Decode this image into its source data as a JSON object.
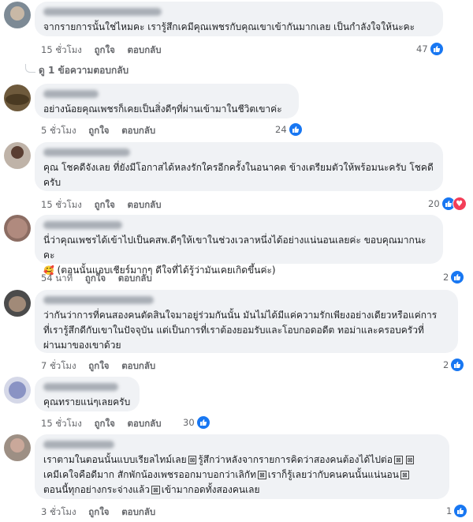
{
  "colors": {
    "bubble": "#f0f2f5",
    "like": "#1877f2",
    "love": "#f33e58",
    "meta": "#65676b"
  },
  "icons": {
    "like": "like-thumb-icon",
    "love": "love-heart-icon"
  },
  "comments": [
    {
      "text": "จากรายการนั้นใช่ไหมคะ เรารู้สึกเคมีคุณเพชรกับคุณเขาเข้ากันมากเลย เป็นกำลังใจให้นะคะ",
      "time": "15 ชั่วโมง",
      "like": "ถูกใจ",
      "reply": "ตอบกลับ",
      "count": "47",
      "replies": "ดู 1 ข้อความตอบกลับ"
    },
    {
      "text": "อย่างน้อยคุณเพชรก็เคยเป็นสิ่งดีๆที่ผ่านเข้ามาในชีวิตเขาค่ะ",
      "time": "5 ชั่วโมง",
      "like": "ถูกใจ",
      "reply": "ตอบกลับ",
      "count": "24"
    },
    {
      "line1": "คุณ โชคดีจังเลย ที่ยังมีโอกาสได้หลงรักใครอีกครั้งในอนาคต ข้างเตรียมตัวให้พร้อมนะครับ โชคดี",
      "line2": "ครับ",
      "time": "15 ชั่วโมง",
      "like": "ถูกใจ",
      "reply": "ตอบกลับ",
      "count": "20"
    },
    {
      "line1": "นี่ว่าคุณเพชรได้เข้าไปเป็นคสพ.ดีๆให้เขาในช่วงเวลาหนึ่งได้อย่างแน่นอนเลยค่ะ ขอบคุณมากนะคะ",
      "emoji": "🥰",
      "line2": "(ตอนนั้นแอบเชียร์มากๆ ดีใจที่ได้รู้ว่ามันเคยเกิดขึ้นค่ะ)",
      "time": "54 นาที",
      "like": "ถูกใจ",
      "reply": "ตอบกลับ",
      "count": "2"
    },
    {
      "line1": "ว่ากันว่าการที่คนสองคนตัดสินใจมาอยู่ร่วมกันนั้น มันไม่ได้มีแค่ความรักเพียงอย่างเดียวหรือแค่การ",
      "line2": "ที่เรารู้สึกดีกับเขาในปัจจุบัน แต่เป็นการที่เราต้องยอมรับและโอบกอดอดีต ทอม่าและครอบครัวที่",
      "line3": "ผ่านมาของเขาด้วย",
      "time": "7 ชั่วโมง",
      "like": "ถูกใจ",
      "reply": "ตอบกลับ",
      "count": "2"
    },
    {
      "text": "คุณทรายแน่ๆเลยครับ",
      "time": "15 ชั่วโมง",
      "like": "ถูกใจ",
      "reply": "ตอบกลับ",
      "count": "30"
    },
    {
      "line1a": "เราตามในตอนนั้นแบบเรียลไทม์เลย",
      "line1b": "รู้สึกว่าหลังจากรายการคิดว่าสองคนต้องได้ไปต่อ",
      "line2a": "เคมีเคใจคือดีมาก สักพักน้องเพชรออกมาบอกว่าเลิกัท",
      "line2b": "เราก็รู้เลยว่ากับคนคนนั้นแน่นอน",
      "line3a": "ตอนนี้ทุกอย่างกระจ่างแล้ว",
      "line3b": "เข้ามากอดทั้งสองคนเลย",
      "box": "⊠",
      "time": "3 ชั่วโมง",
      "like": "ถูกใจ",
      "reply": "ตอบกลับ",
      "count": "1"
    }
  ]
}
